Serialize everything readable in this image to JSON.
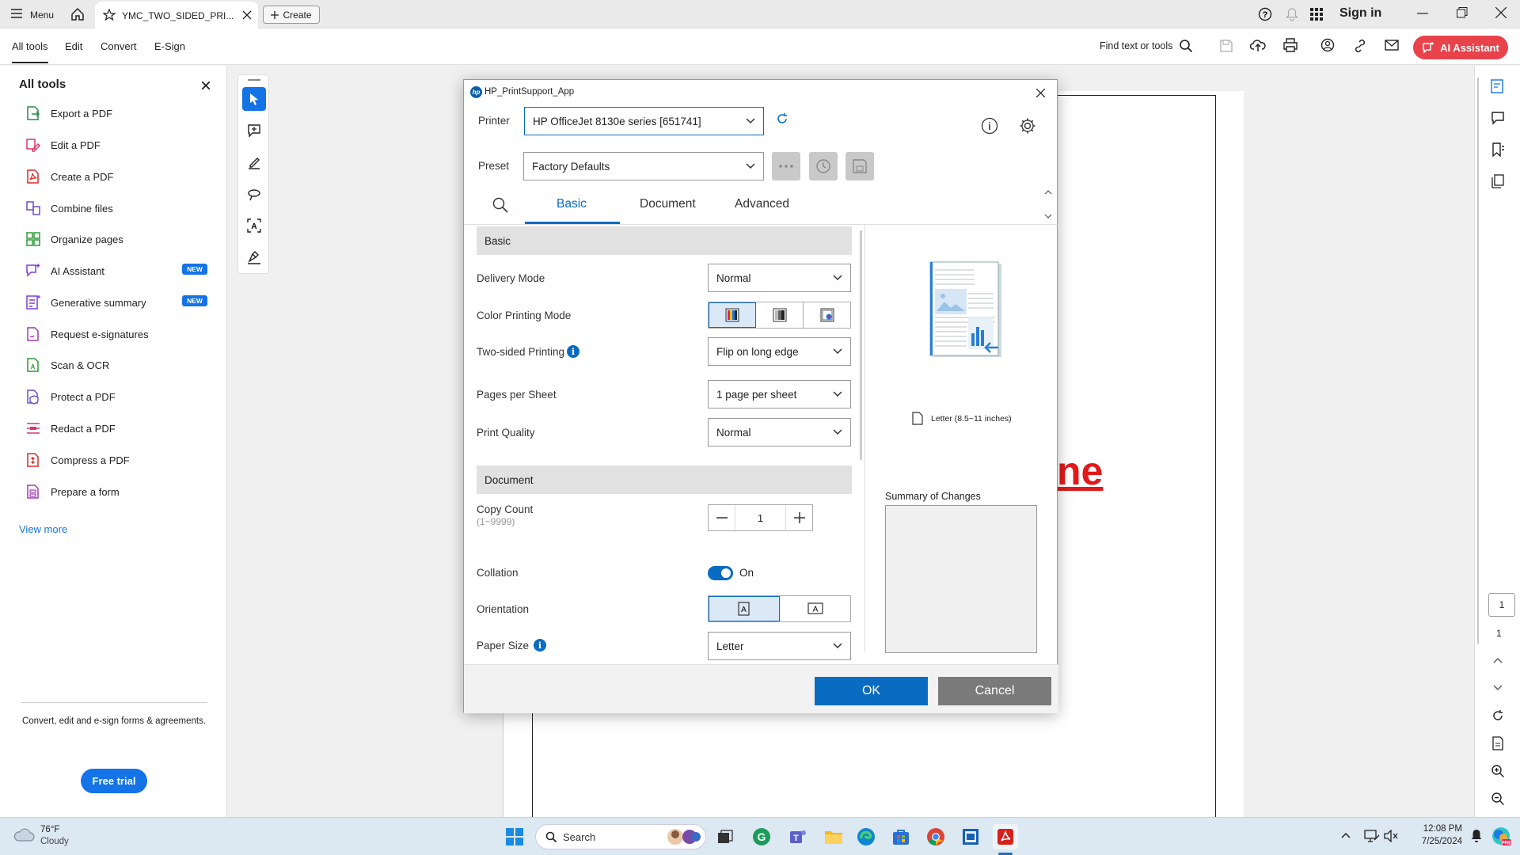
{
  "titlebar": {
    "menu": "Menu",
    "tab_title": "YMC_TWO_SIDED_PRI...",
    "create": "Create",
    "sign_in": "Sign in"
  },
  "menubar": {
    "items": [
      "All tools",
      "Edit",
      "Convert",
      "E-Sign"
    ],
    "find": "Find text or tools",
    "ai_assistant": "AI Assistant"
  },
  "left_panel": {
    "title": "All tools",
    "tools": [
      {
        "label": "Export a PDF",
        "icon": "export-pdf-icon",
        "color": "#2a8b4a"
      },
      {
        "label": "Edit a PDF",
        "icon": "edit-pdf-icon",
        "color": "#d3386b"
      },
      {
        "label": "Create a PDF",
        "icon": "create-pdf-icon",
        "color": "#d72b2b"
      },
      {
        "label": "Combine files",
        "icon": "combine-files-icon",
        "color": "#6a4fc8"
      },
      {
        "label": "Organize pages",
        "icon": "organize-pages-icon",
        "color": "#2f9a37"
      },
      {
        "label": "AI Assistant",
        "icon": "ai-assistant-icon",
        "color": "#7b3fd6",
        "badge": "NEW"
      },
      {
        "label": "Generative summary",
        "icon": "generative-summary-icon",
        "color": "#7b3fd6",
        "badge": "NEW"
      },
      {
        "label": "Request e-signatures",
        "icon": "request-esignatures-icon",
        "color": "#a23bb6"
      },
      {
        "label": "Scan & OCR",
        "icon": "scan-ocr-icon",
        "color": "#2f9a37"
      },
      {
        "label": "Protect a PDF",
        "icon": "protect-pdf-icon",
        "color": "#6a4fc8"
      },
      {
        "label": "Redact a PDF",
        "icon": "redact-pdf-icon",
        "color": "#d3386b"
      },
      {
        "label": "Compress a PDF",
        "icon": "compress-pdf-icon",
        "color": "#d72b2b"
      },
      {
        "label": "Prepare a form",
        "icon": "prepare-form-icon",
        "color": "#a23bb6"
      }
    ],
    "view_more": "View more",
    "promo": "Convert, edit and e-sign forms & agreements.",
    "free_trial": "Free trial"
  },
  "document": {
    "visible_text": "ne"
  },
  "right_rail": {
    "page_current": "1",
    "page_total": "1"
  },
  "dialog": {
    "title": "HP_PrintSupport_App",
    "printer_label": "Printer",
    "printer_value": "HP OfficeJet 8130e series [651741]",
    "preset_label": "Preset",
    "preset_value": "Factory Defaults",
    "tabs": [
      "Basic",
      "Document",
      "Advanced"
    ],
    "active_tab": "Basic",
    "basic_section": "Basic",
    "delivery_mode": {
      "label": "Delivery Mode",
      "value": "Normal"
    },
    "color_mode": {
      "label": "Color Printing Mode",
      "options": [
        "color",
        "grayscale",
        "color-pick"
      ],
      "selected": 0
    },
    "two_sided": {
      "label": "Two-sided Printing",
      "value": "Flip on long edge"
    },
    "pages_per_sheet": {
      "label": "Pages per Sheet",
      "value": "1 page per sheet"
    },
    "print_quality": {
      "label": "Print Quality",
      "value": "Normal"
    },
    "document_section": "Document",
    "copy_count": {
      "label": "Copy Count",
      "range": "(1~9999)",
      "value": "1"
    },
    "collation": {
      "label": "Collation",
      "value": "On"
    },
    "orientation": {
      "label": "Orientation",
      "selected": "portrait"
    },
    "paper_size": {
      "label": "Paper Size",
      "value": "Letter"
    },
    "preview": {
      "paper": "Letter (8.5~11 inches)",
      "summary_label": "Summary of Changes"
    },
    "ok": "OK",
    "cancel": "Cancel"
  },
  "taskbar": {
    "weather_temp": "76°F",
    "weather_desc": "Cloudy",
    "search": "Search",
    "time": "12:08 PM",
    "date": "7/25/2024"
  }
}
